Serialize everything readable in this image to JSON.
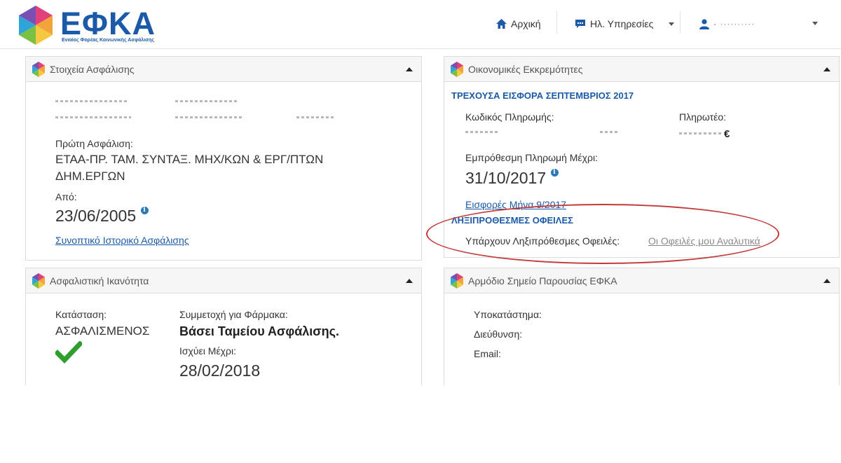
{
  "header": {
    "logo_text": "ΕΦΚΑ",
    "logo_subtitle": "Ενιαίος Φορέας Κοινωνικής Ασφάλισης",
    "nav": {
      "home_label": "Αρχική",
      "services_label": "Ηλ. Υπηρεσίες",
      "user_name": "- ··········"
    }
  },
  "insurance_panel": {
    "title": "Στοιχεία Ασφάλισης",
    "first_insurance_label": "Πρώτη Ασφάλιση:",
    "first_insurance_value_line1": "ΕΤΑΑ-ΠΡ. ΤΑΜ. ΣΥΝΤΑΞ. ΜΗΧ/ΚΩΝ & ΕΡΓ/ΠΤΩΝ",
    "first_insurance_value_line2": "ΔΗΜ.ΕΡΓΩΝ",
    "from_label": "Από:",
    "from_date": "23/06/2005",
    "history_link": "Συνοπτικό Ιστορικό Ασφάλισης"
  },
  "financial_panel": {
    "title": "Οικονομικές Εκκρεμότητες",
    "current_section": "ΤΡΕΧΟΥΣΑ ΕΙΣΦΟΡΑ ΣΕΠΤΕΜΒΡΙΟΣ 2017",
    "payment_code_label": "Κωδικός Πληρωμής:",
    "payable_label": "Πληρωτέο:",
    "currency_symbol": "€",
    "due_label": "Εμπρόθεσμη Πληρωμή Μέχρι:",
    "due_date": "31/10/2017",
    "contributions_link": "Εισφορές Μήνα 9/2017",
    "overdue_section": "ΛΗΞΙΠΡΟΘΕΣΜΕΣ ΟΦΕΙΛΕΣ",
    "overdue_label": "Υπάρχουν Ληξιπρόθεσμες Οφειλές:",
    "overdue_link": "Οι Οφειλές μου Αναλυτικά"
  },
  "capacity_panel": {
    "title": "Ασφαλιστική Ικανότητα",
    "status_label": "Κατάσταση:",
    "status_value": "ΑΣΦΑΛΙΣΜΕΝΟΣ",
    "pharma_label": "Συμμετοχή για Φάρμακα:",
    "pharma_value": "Βάσει Ταμείου Ασφάλισης.",
    "valid_label": "Ισχύει Μέχρι:",
    "valid_date": "28/02/2018"
  },
  "office_panel": {
    "title": "Αρμόδιο Σημείο Παρουσίας ΕΦΚΑ",
    "branch_label": "Υποκατάστημα:",
    "address_label": "Διεύθυνση:",
    "email_label": "Email:"
  },
  "colors": {
    "brand_blue": "#1a5aa8",
    "annotation_red": "#c23a3a",
    "check_green": "#2e9e2e"
  }
}
